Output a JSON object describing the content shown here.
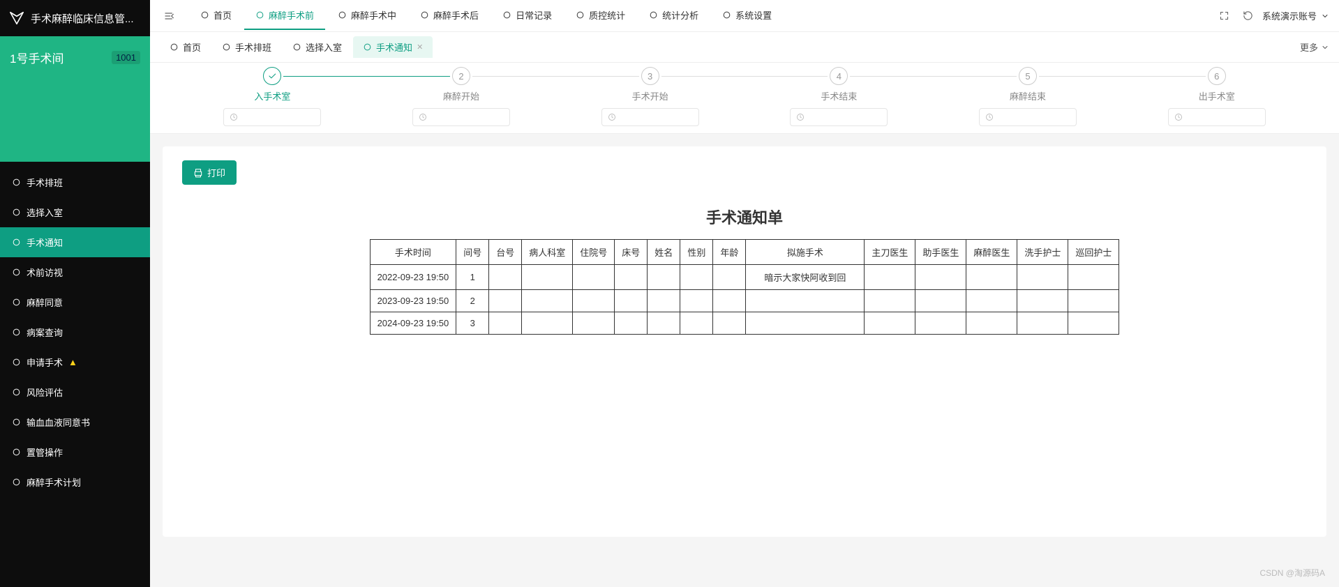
{
  "app": {
    "title": "手术麻醉临床信息管..."
  },
  "room": {
    "name": "1号手术间",
    "number": "1001"
  },
  "sidebar": {
    "items": [
      {
        "label": "手术排班",
        "icon": "clock-icon"
      },
      {
        "label": "选择入室",
        "icon": "enter-icon"
      },
      {
        "label": "手术通知",
        "icon": "notice-icon",
        "active": true
      },
      {
        "label": "术前访视",
        "icon": "visit-icon"
      },
      {
        "label": "麻醉同意",
        "icon": "consent-icon"
      },
      {
        "label": "病案查询",
        "icon": "case-icon"
      },
      {
        "label": "申请手术",
        "icon": "apply-icon",
        "warn": true
      },
      {
        "label": "风险评估",
        "icon": "risk-icon"
      },
      {
        "label": "输血血液同意书",
        "icon": "blood-icon"
      },
      {
        "label": "置管操作",
        "icon": "cath-icon"
      },
      {
        "label": "麻醉手术计划",
        "icon": "plan-icon"
      }
    ]
  },
  "topnav": {
    "items": [
      {
        "label": "首页",
        "icon": "home-icon"
      },
      {
        "label": "麻醉手术前",
        "icon": "pre-icon",
        "active": true
      },
      {
        "label": "麻醉手术中",
        "icon": "during-icon"
      },
      {
        "label": "麻醉手术后",
        "icon": "post-icon"
      },
      {
        "label": "日常记录",
        "icon": "daily-icon"
      },
      {
        "label": "质控统计",
        "icon": "qc-icon"
      },
      {
        "label": "统计分析",
        "icon": "stats-icon"
      },
      {
        "label": "系统设置",
        "icon": "settings-icon"
      }
    ],
    "user": "系统演示账号"
  },
  "tabs": {
    "items": [
      {
        "label": "首页",
        "closable": false,
        "icon": "home-icon"
      },
      {
        "label": "手术排班",
        "closable": false,
        "icon": "clock-icon"
      },
      {
        "label": "选择入室",
        "closable": false,
        "icon": "enter-icon"
      },
      {
        "label": "手术通知",
        "closable": true,
        "icon": "notice-icon",
        "active": true
      }
    ],
    "more": "更多"
  },
  "steps": {
    "items": [
      {
        "num": "✓",
        "label": "入手术室",
        "done": true
      },
      {
        "num": "2",
        "label": "麻醉开始"
      },
      {
        "num": "3",
        "label": "手术开始"
      },
      {
        "num": "4",
        "label": "手术结束"
      },
      {
        "num": "5",
        "label": "麻醉结束"
      },
      {
        "num": "6",
        "label": "出手术室"
      }
    ]
  },
  "actions": {
    "print": "打印"
  },
  "doc": {
    "title": "手术通知单",
    "columns": [
      "手术时间",
      "间号",
      "台号",
      "病人科室",
      "住院号",
      "床号",
      "姓名",
      "性别",
      "年龄",
      "拟施手术",
      "主刀医生",
      "助手医生",
      "麻醉医生",
      "洗手护士",
      "巡回护士"
    ],
    "rows": [
      {
        "time": "2022-09-23 19:50",
        "room": "1",
        "table": "",
        "dept": "",
        "inpatient": "",
        "bed": "",
        "name": "",
        "sex": "",
        "age": "",
        "op": "暗示大家快阿收到回",
        "surgeon": "",
        "assist": "",
        "anes": "",
        "scrub": "",
        "circ": ""
      },
      {
        "time": "2023-09-23 19:50",
        "room": "2",
        "table": "",
        "dept": "",
        "inpatient": "",
        "bed": "",
        "name": "",
        "sex": "",
        "age": "",
        "op": "",
        "surgeon": "",
        "assist": "",
        "anes": "",
        "scrub": "",
        "circ": ""
      },
      {
        "time": "2024-09-23 19:50",
        "room": "3",
        "table": "",
        "dept": "",
        "inpatient": "",
        "bed": "",
        "name": "",
        "sex": "",
        "age": "",
        "op": "",
        "surgeon": "",
        "assist": "",
        "anes": "",
        "scrub": "",
        "circ": ""
      }
    ]
  },
  "watermark": "CSDN @淘源码A"
}
